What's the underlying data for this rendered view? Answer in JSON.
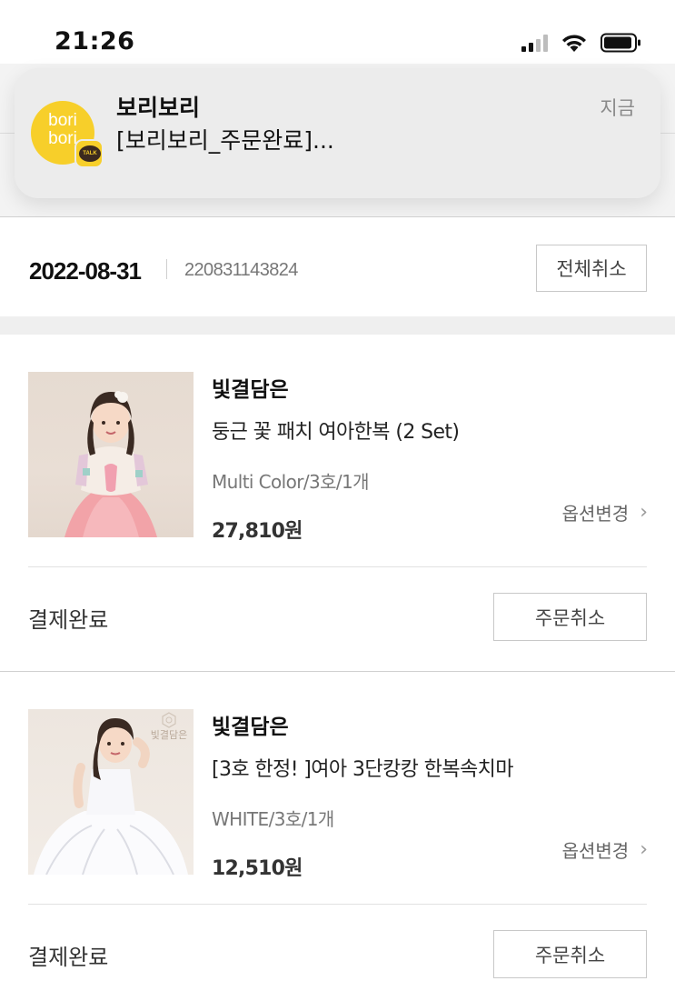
{
  "status_bar": {
    "time": "21:26",
    "icons": [
      "cellular-signal-icon",
      "wifi-icon",
      "battery-icon"
    ]
  },
  "notification": {
    "app_icon_text": "bori\nbori",
    "badge_text": "TALK",
    "sender": "보리보리",
    "message": "[보리보리_주문완료]...",
    "time": "지금"
  },
  "order": {
    "date": "2022-08-31",
    "number": "220831143824",
    "cancel_all_label": "전체취소"
  },
  "items": [
    {
      "brand": "빛결담은",
      "name": "둥근 꽃 패치 여아한복 (2 Set)",
      "option": "Multi Color/3호/1개",
      "price": "27,810원",
      "option_change_label": "옵션변경",
      "status": "결제완료",
      "cancel_label": "주문취소"
    },
    {
      "brand": "빛결담은",
      "name": "[3호 한정! ]여아 3단캉캉 한복속치마",
      "option": "WHITE/3호/1개",
      "price": "12,510원",
      "option_change_label": "옵션변경",
      "status": "결제완료",
      "cancel_label": "주문취소",
      "image_watermark": "빛결담은"
    }
  ],
  "colors": {
    "kakao_yellow": "#f7cf2a",
    "border": "#c8c8c8",
    "section_gap": "#efefef"
  }
}
